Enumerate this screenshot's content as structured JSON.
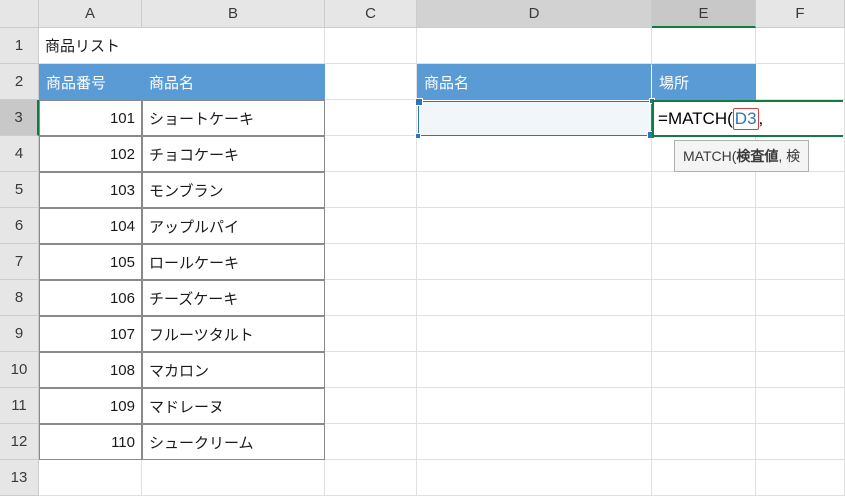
{
  "columns": [
    "A",
    "B",
    "C",
    "D",
    "E",
    "F"
  ],
  "rows": [
    "1",
    "2",
    "3",
    "4",
    "5",
    "6",
    "7",
    "8",
    "9",
    "10",
    "11",
    "12",
    "13"
  ],
  "a1": "商品リスト",
  "headers": {
    "a2": "商品番号",
    "b2": "商品名",
    "d2": "商品名",
    "e2": "場所"
  },
  "table": [
    {
      "no": "101",
      "name": "ショートケーキ"
    },
    {
      "no": "102",
      "name": "チョコケーキ"
    },
    {
      "no": "103",
      "name": "モンブラン"
    },
    {
      "no": "104",
      "name": "アップルパイ"
    },
    {
      "no": "105",
      "name": "ロールケーキ"
    },
    {
      "no": "106",
      "name": "チーズケーキ"
    },
    {
      "no": "107",
      "name": "フルーツタルト"
    },
    {
      "no": "108",
      "name": "マカロン"
    },
    {
      "no": "109",
      "name": "マドレーヌ"
    },
    {
      "no": "110",
      "name": "シュークリーム"
    }
  ],
  "formula": {
    "eq": "=",
    "fn": "MATCH",
    "open": "(",
    "ref": "D3",
    "comma": ","
  },
  "tooltip": {
    "fn": "MATCH(",
    "arg1": "検査値",
    "rest": ", 検"
  }
}
